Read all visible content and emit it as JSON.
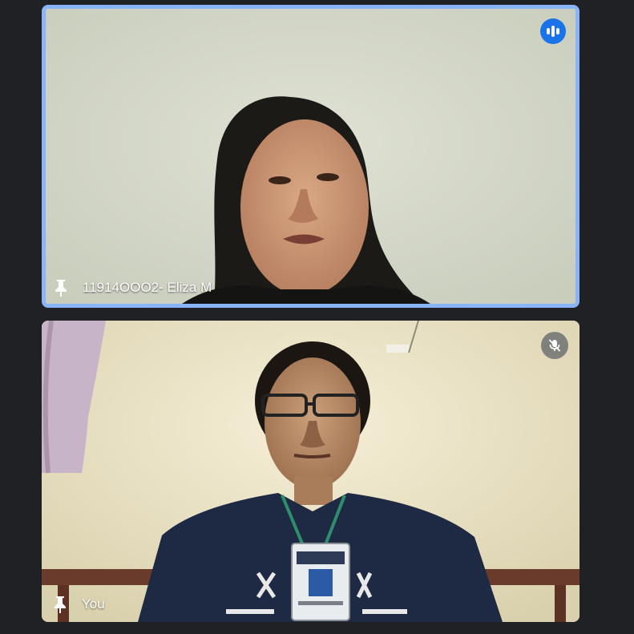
{
  "tiles": [
    {
      "name": "11914OOO2- Eliza M",
      "status_icon": "speaking-indicator-icon",
      "pin_icon": "pin-icon"
    },
    {
      "name": "You",
      "status_icon": "mic-off-icon",
      "pin_icon": "pin-icon"
    }
  ],
  "colors": {
    "background": "#202124",
    "active_speaker_border": "#8ab4f8",
    "speaking_badge": "#1a73e8"
  }
}
